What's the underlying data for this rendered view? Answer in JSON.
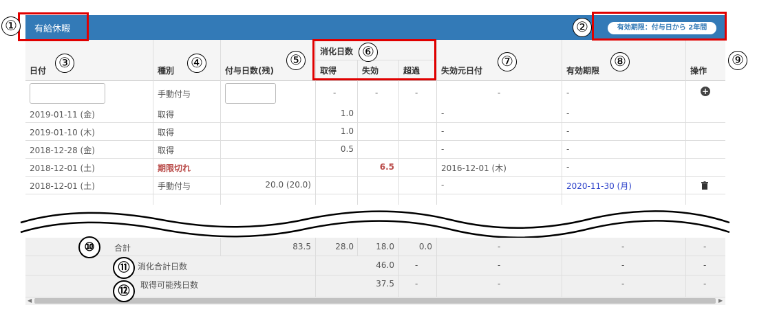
{
  "header": {
    "title": "有給休暇",
    "validity_badge": "有効期限：付与日から 2年間"
  },
  "markers": {
    "n1": "①",
    "n2": "②",
    "n3": "③",
    "n4": "④",
    "n5": "⑤",
    "n6": "⑥",
    "n7": "⑦",
    "n8": "⑧",
    "n9": "⑨",
    "n10": "⑩",
    "n11": "⑪",
    "n12": "⑫"
  },
  "columns": {
    "date": "日付",
    "type": "種別",
    "granted": "付与日数(残)",
    "consumed_group": "消化日数",
    "acquired": "取得",
    "expired": "失効",
    "excess": "超過",
    "expire_source": "失効元日付",
    "expiry": "有効期限",
    "action": "操作"
  },
  "input_row": {
    "type": "手動付与",
    "acquired": "-",
    "expired": "-",
    "excess": "-",
    "expire_source": "-",
    "expiry": "-",
    "add_icon": "plus-circle-icon"
  },
  "rows": [
    {
      "date": "2019-01-11 (金)",
      "type": "取得",
      "granted": "",
      "acquired": "1.0",
      "expired": "",
      "excess": "",
      "expire_source": "-",
      "expiry": "-"
    },
    {
      "date": "2019-01-10 (木)",
      "type": "取得",
      "granted": "",
      "acquired": "1.0",
      "expired": "",
      "excess": "",
      "expire_source": "-",
      "expiry": "-"
    },
    {
      "date": "2018-12-28 (金)",
      "type": "取得",
      "granted": "",
      "acquired": "0.5",
      "expired": "",
      "excess": "",
      "expire_source": "-",
      "expiry": "-"
    },
    {
      "date": "2018-12-01 (土)",
      "type": "期限切れ",
      "granted": "",
      "acquired": "",
      "expired": "6.5",
      "excess": "",
      "expire_source": "2016-12-01 (木)",
      "expiry": "-"
    },
    {
      "date": "2018-12-01 (土)",
      "type": "手動付与",
      "granted": "20.0 (20.0)",
      "acquired": "",
      "expired": "",
      "excess": "",
      "expire_source": "-",
      "expiry": "2020-11-30 (月)",
      "delete_icon": "trash-icon"
    }
  ],
  "totals": {
    "label": "合計",
    "granted": "83.5",
    "acquired": "28.0",
    "expired": "18.0",
    "excess": "0.0",
    "expire_source": "-",
    "expiry": "-",
    "action": "-"
  },
  "consumed_total": {
    "label": "消化合計日数",
    "value": "46.0",
    "excess": "-",
    "expire_source": "-",
    "expiry": "-",
    "action": "-"
  },
  "remaining": {
    "label": "取得可能残日数",
    "value": "37.5",
    "excess": "-",
    "expire_source": "-",
    "expiry": "-",
    "action": "-"
  },
  "colors": {
    "header_bg": "#337ab7",
    "annotation_red": "#e00000",
    "expired_text": "#b94a48",
    "expiry_link": "#2a3fc9"
  }
}
